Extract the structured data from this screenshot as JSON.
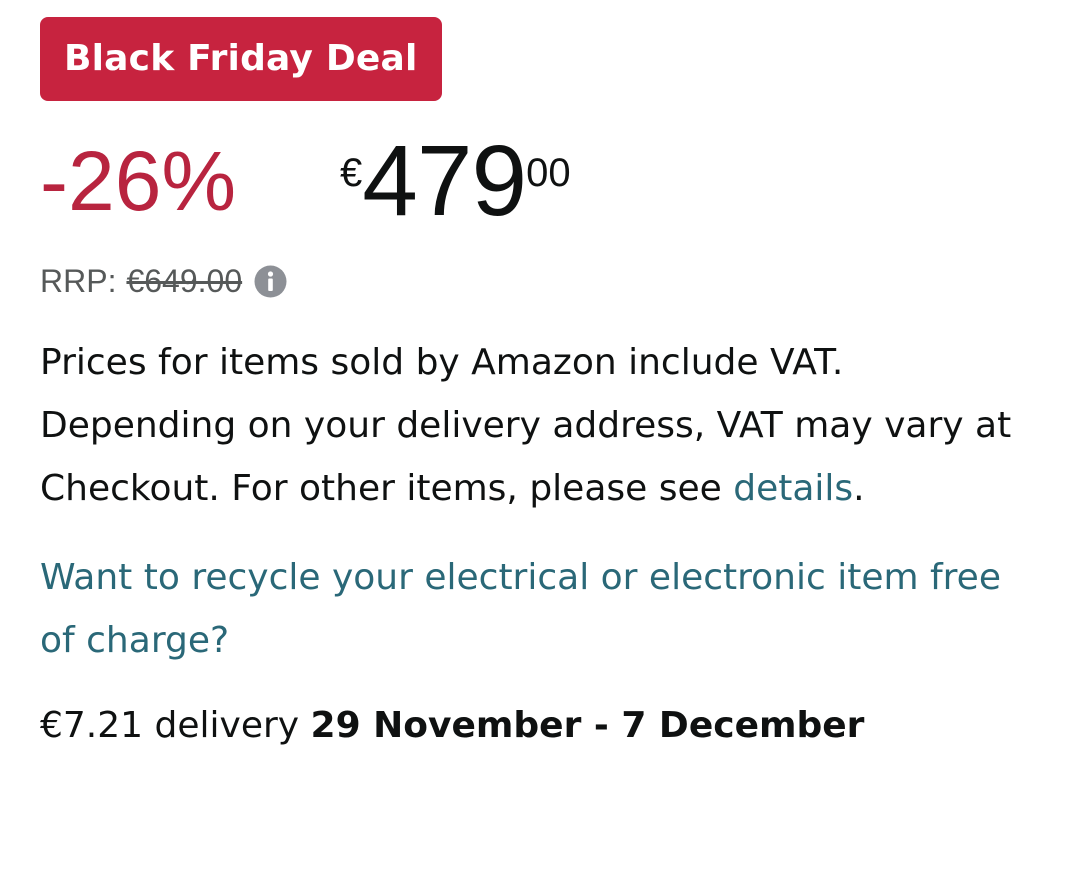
{
  "deal": {
    "badge_label": "Black Friday Deal"
  },
  "price": {
    "discount": "-26%",
    "currency": "€",
    "whole": "479",
    "fraction": "00",
    "rrp_label": "RRP:",
    "rrp_value": "€649.00"
  },
  "vat": {
    "text": "Prices for items sold by Amazon include VAT. Depending on your delivery address, VAT may vary at Checkout. For other items, please see ",
    "link_label": "details",
    "suffix": "."
  },
  "recycle": {
    "label": "Want to recycle your electrical or electronic item free of charge?"
  },
  "delivery": {
    "cost": "€7.21 delivery ",
    "dates": "29 November - 7 December"
  },
  "colors": {
    "badge_bg": "#c7233f",
    "discount": "#b8243f",
    "link": "#2a6878",
    "muted": "#565959"
  }
}
